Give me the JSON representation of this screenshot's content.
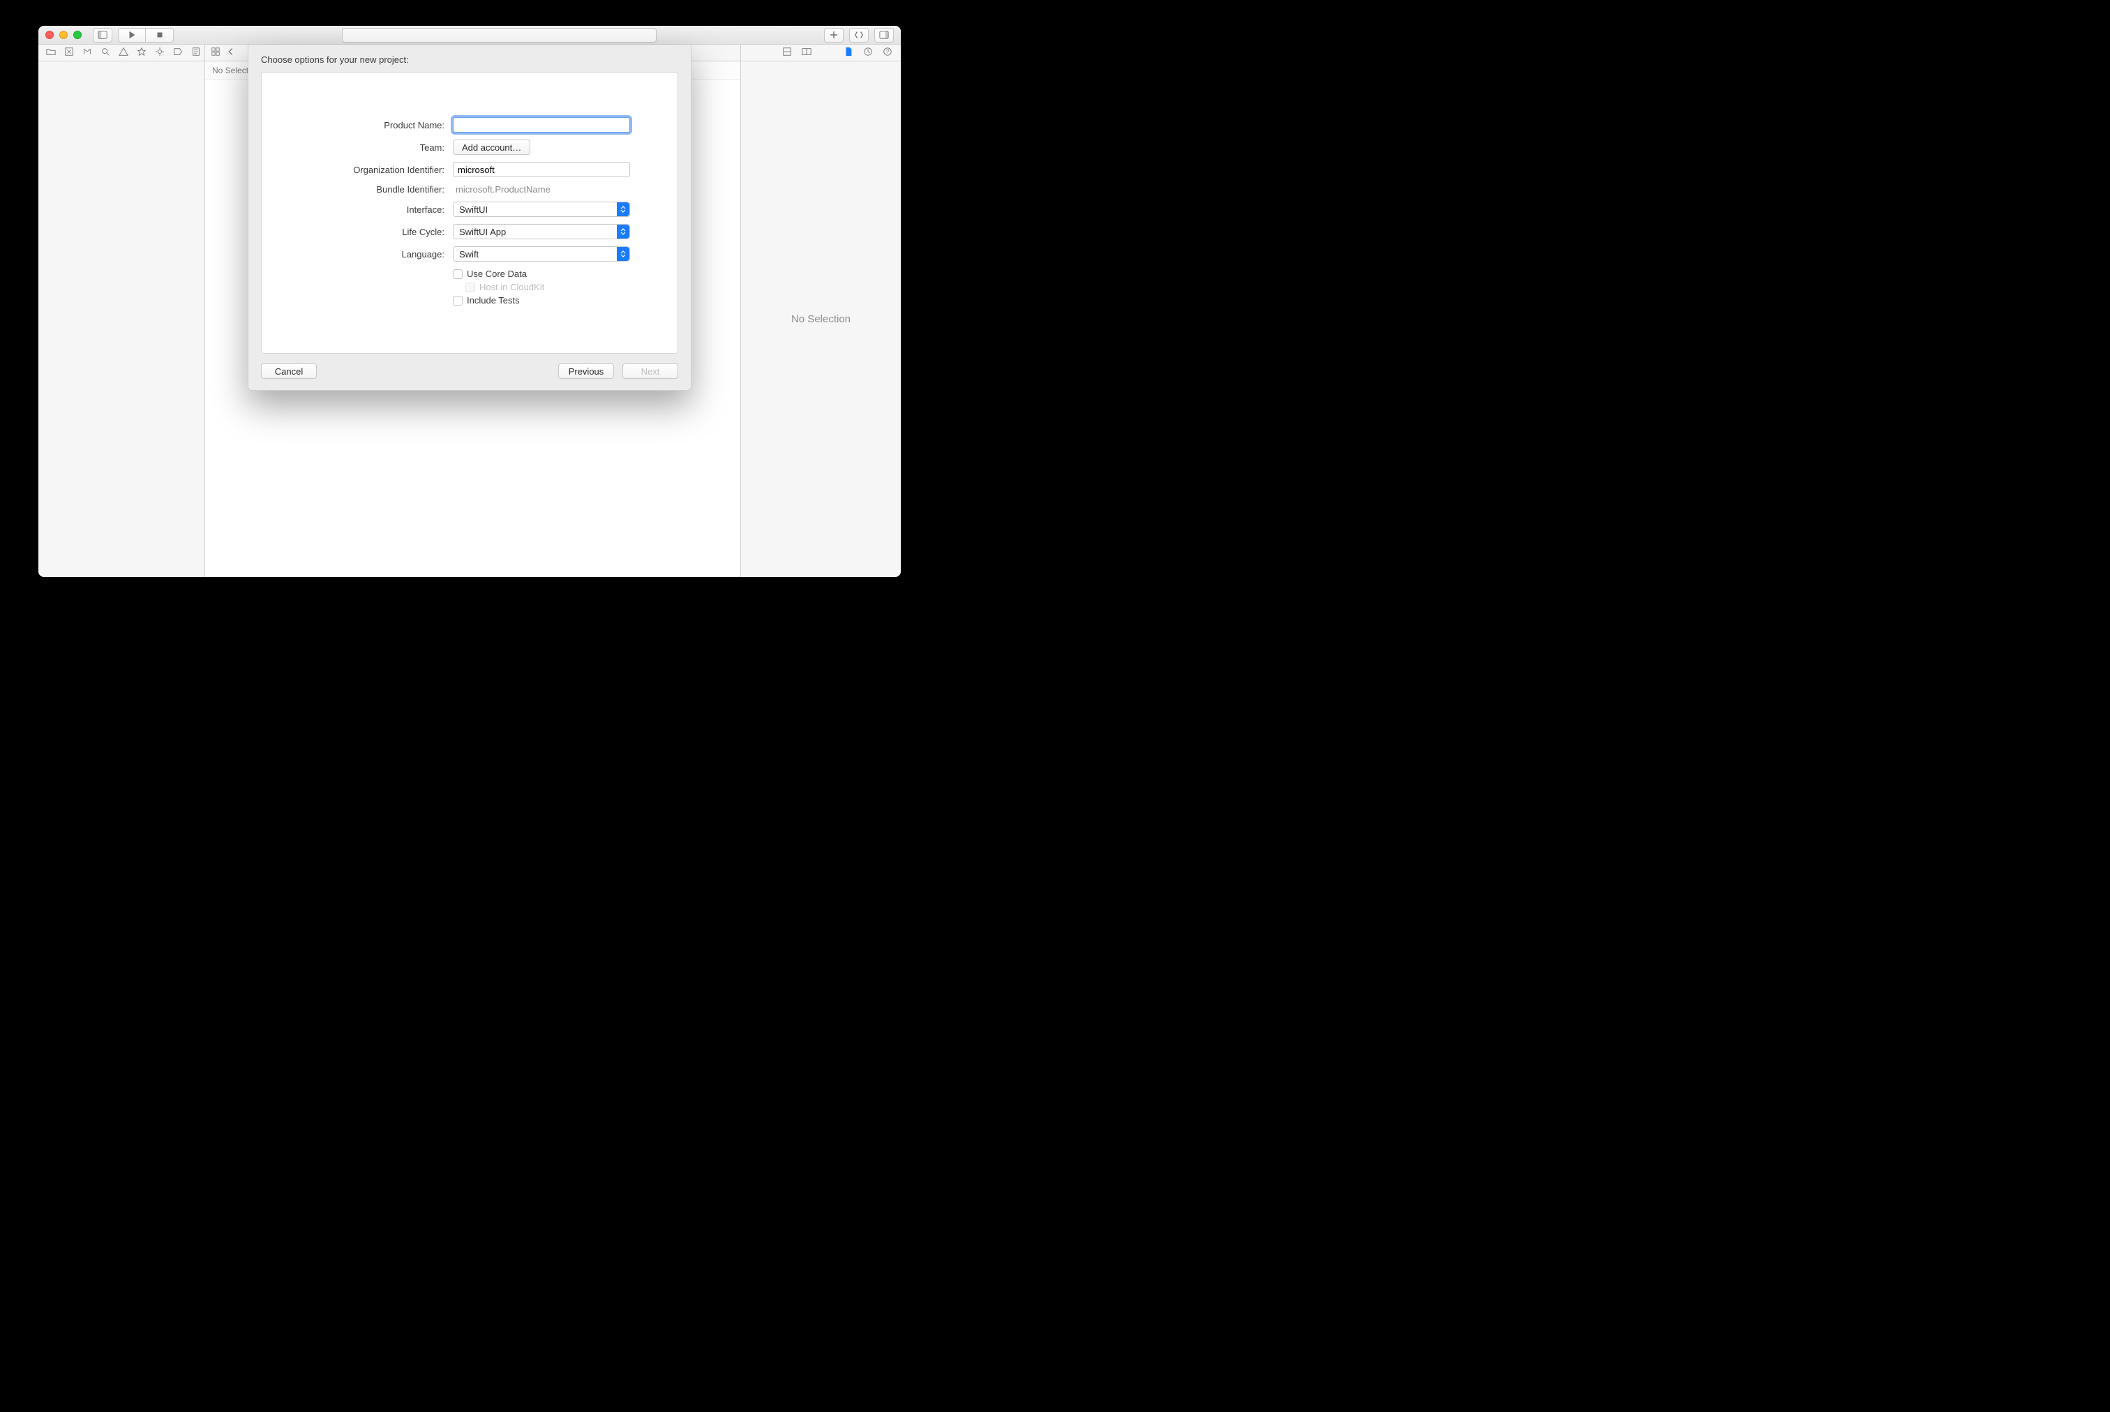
{
  "titlebar": {
    "search_placeholder": ""
  },
  "editor": {
    "jumpbar_text": "No Selection"
  },
  "inspector": {
    "empty_text": "No Selection"
  },
  "sheet": {
    "title": "Choose options for your new project:",
    "fields": {
      "product_name": {
        "label": "Product Name:",
        "value": ""
      },
      "team": {
        "label": "Team:",
        "button": "Add account…"
      },
      "org_id": {
        "label": "Organization Identifier:",
        "value": "microsoft"
      },
      "bundle_id": {
        "label": "Bundle Identifier:",
        "value": "microsoft.ProductName"
      },
      "interface": {
        "label": "Interface:",
        "value": "SwiftUI"
      },
      "life_cycle": {
        "label": "Life Cycle:",
        "value": "SwiftUI App"
      },
      "language": {
        "label": "Language:",
        "value": "Swift"
      },
      "use_core_data": {
        "label": "Use Core Data",
        "checked": false
      },
      "host_cloudkit": {
        "label": "Host in CloudKit",
        "checked": false,
        "disabled": true
      },
      "include_tests": {
        "label": "Include Tests",
        "checked": false
      }
    },
    "buttons": {
      "cancel": "Cancel",
      "previous": "Previous",
      "next": "Next"
    }
  }
}
